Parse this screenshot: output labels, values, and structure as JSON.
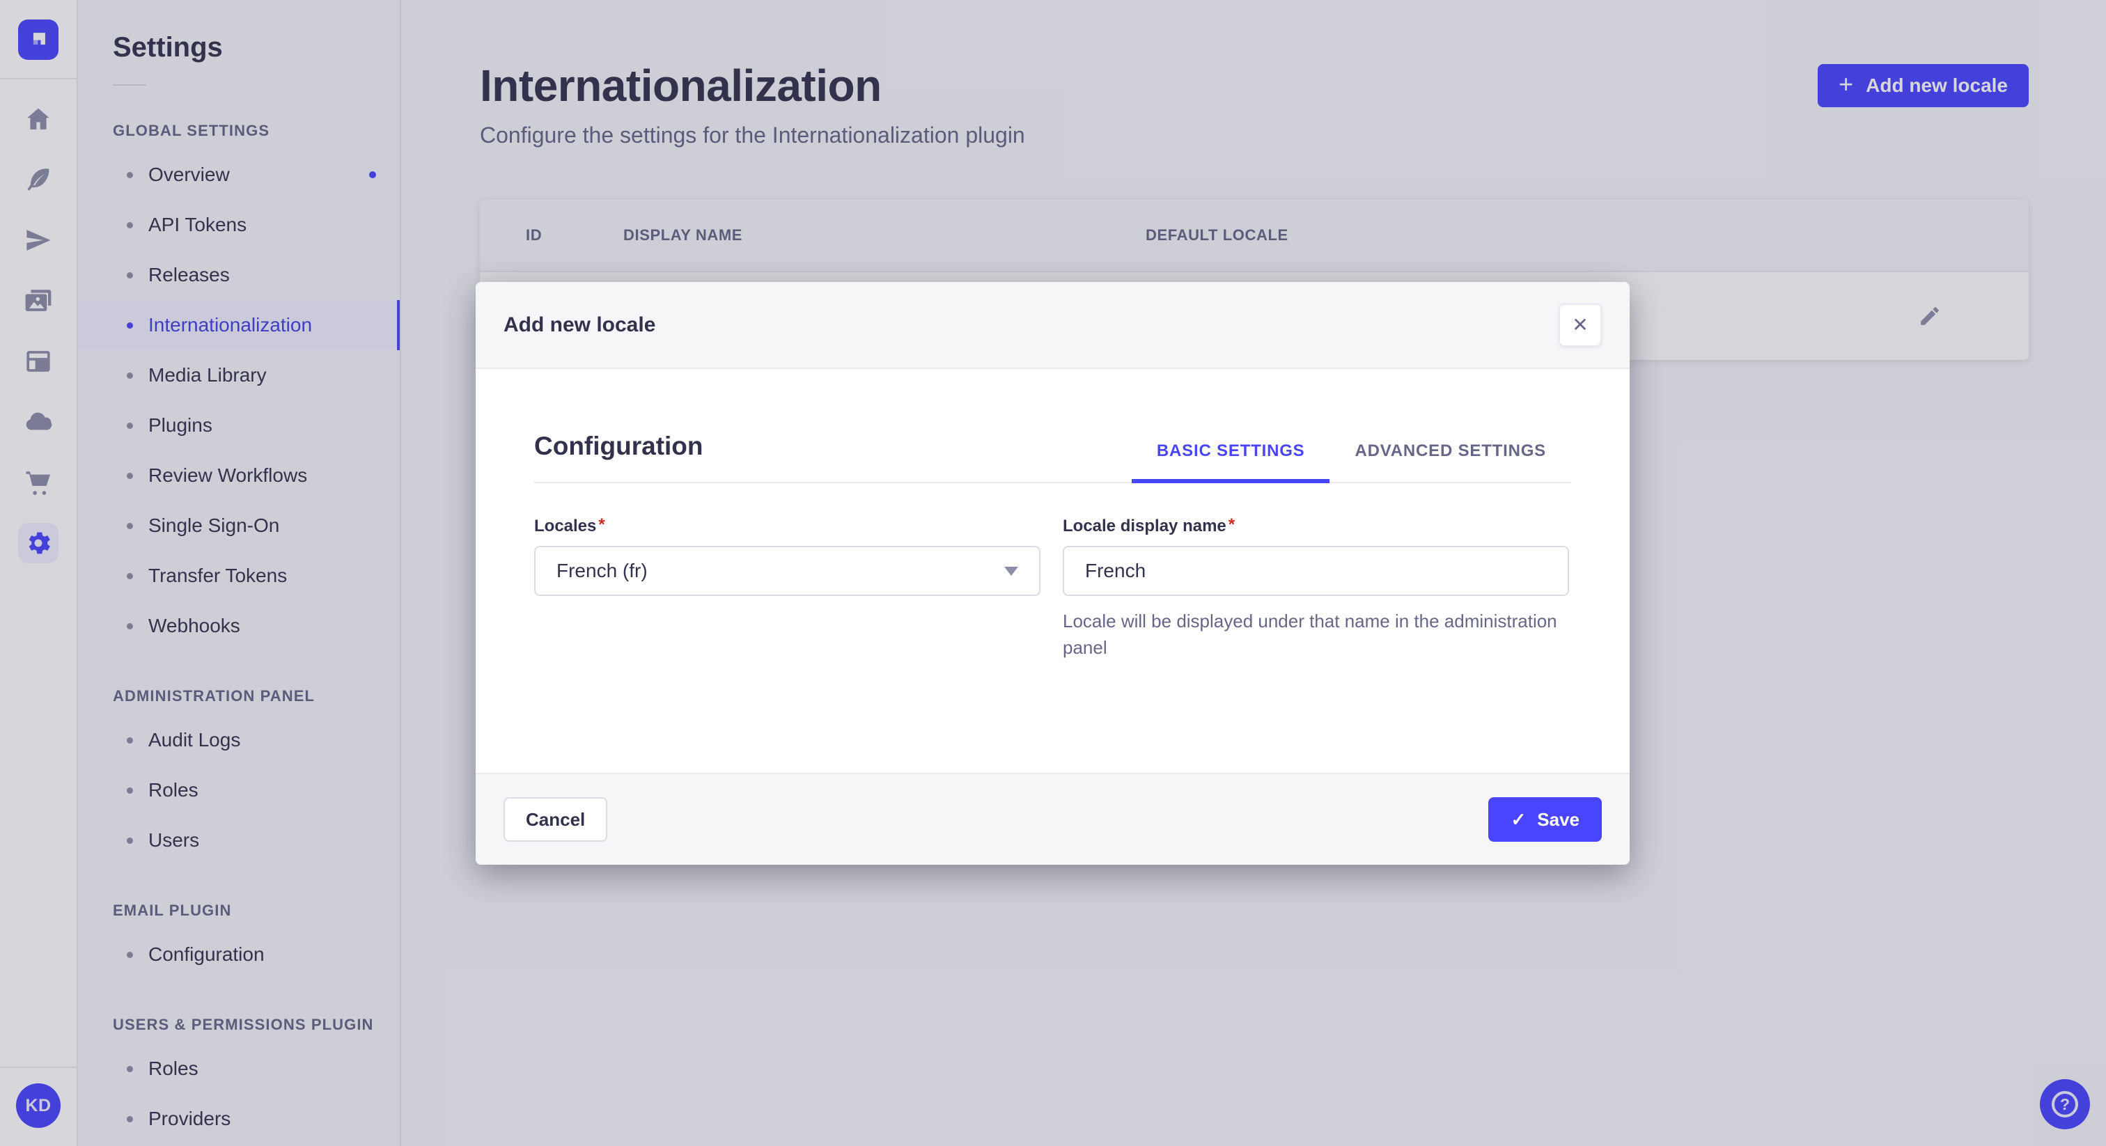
{
  "colors": {
    "accent": "#4945ff",
    "accent_light": "#f0f0ff",
    "text_dark": "#32324d",
    "text_muted": "#666687",
    "icon_grey": "#8e8ea9",
    "border": "#eaeaef",
    "surface": "#f6f6f9",
    "required_red": "#d02b20"
  },
  "icons": {
    "plus": "+",
    "close": "✕",
    "check": "✓",
    "question": "?"
  },
  "user": {
    "initials": "KD"
  },
  "settings_nav": {
    "title": "Settings",
    "sections": [
      {
        "label": "GLOBAL SETTINGS",
        "items": [
          {
            "label": "Overview",
            "has_notification": true
          },
          {
            "label": "API Tokens"
          },
          {
            "label": "Releases"
          },
          {
            "label": "Internationalization",
            "active": true
          },
          {
            "label": "Media Library"
          },
          {
            "label": "Plugins"
          },
          {
            "label": "Review Workflows"
          },
          {
            "label": "Single Sign-On"
          },
          {
            "label": "Transfer Tokens"
          },
          {
            "label": "Webhooks"
          }
        ]
      },
      {
        "label": "ADMINISTRATION PANEL",
        "items": [
          {
            "label": "Audit Logs"
          },
          {
            "label": "Roles"
          },
          {
            "label": "Users"
          }
        ]
      },
      {
        "label": "EMAIL PLUGIN",
        "items": [
          {
            "label": "Configuration"
          }
        ]
      },
      {
        "label": "USERS & PERMISSIONS PLUGIN",
        "items": [
          {
            "label": "Roles"
          },
          {
            "label": "Providers"
          }
        ]
      }
    ]
  },
  "header": {
    "title": "Internationalization",
    "subtitle": "Configure the settings for the Internationalization plugin",
    "add_button_label": "Add new locale"
  },
  "table": {
    "columns": [
      "ID",
      "DISPLAY NAME",
      "DEFAULT LOCALE"
    ]
  },
  "modal": {
    "title": "Add new locale",
    "section_title": "Configuration",
    "required_marker": "*",
    "tabs": [
      {
        "label": "BASIC SETTINGS",
        "active": true
      },
      {
        "label": "ADVANCED SETTINGS",
        "active": false
      }
    ],
    "fields": {
      "locales": {
        "label": "Locales",
        "value": "French (fr)"
      },
      "display_name": {
        "label": "Locale display name",
        "value": "French",
        "hint": "Locale will be displayed under that name in the administration panel"
      }
    },
    "cancel_label": "Cancel",
    "save_label": "Save"
  }
}
